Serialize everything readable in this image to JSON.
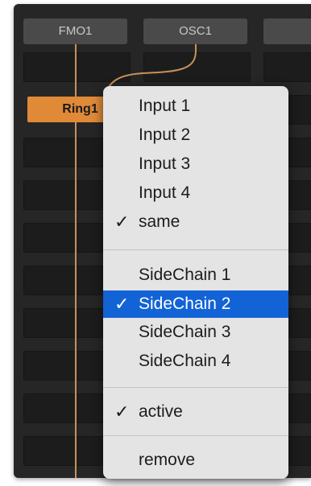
{
  "modules": {
    "fmo1": "FMO1",
    "osc1": "OSC1",
    "ring1": "Ring1"
  },
  "menu": {
    "inputs": [
      {
        "label": "Input 1",
        "checked": false
      },
      {
        "label": "Input 2",
        "checked": false
      },
      {
        "label": "Input 3",
        "checked": false
      },
      {
        "label": "Input 4",
        "checked": false
      },
      {
        "label": "same",
        "checked": true
      }
    ],
    "sidechains": [
      {
        "label": "SideChain 1",
        "checked": false
      },
      {
        "label": "SideChain 2",
        "checked": true,
        "highlighted": true
      },
      {
        "label": "SideChain 3",
        "checked": false
      },
      {
        "label": "SideChain 4",
        "checked": false
      }
    ],
    "active": {
      "label": "active",
      "checked": true
    },
    "remove": {
      "label": "remove"
    },
    "check_glyph": "✓"
  },
  "colors": {
    "module_active": "#e08a38",
    "wire": "#c9915a",
    "menu_highlight": "#1263d6",
    "menu_bg": "#e4e4e4"
  }
}
